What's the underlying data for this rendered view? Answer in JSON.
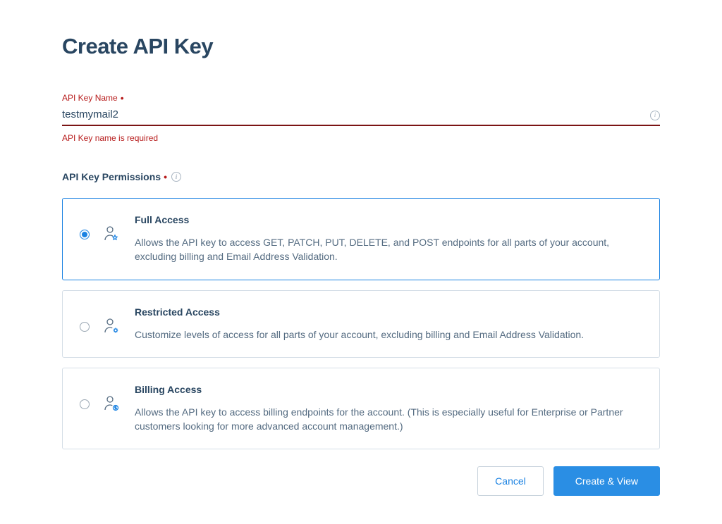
{
  "page_title": "Create API Key",
  "name_field": {
    "label": "API Key Name",
    "value": "testmymail2",
    "error": "API Key name is required"
  },
  "permissions_label": "API Key Permissions",
  "options": [
    {
      "key": "full",
      "title": "Full Access",
      "description": "Allows the API key to access GET, PATCH, PUT, DELETE, and POST endpoints for all parts of your account, excluding billing and Email Address Validation.",
      "selected": true
    },
    {
      "key": "restricted",
      "title": "Restricted Access",
      "description": "Customize levels of access for all parts of your account, excluding billing and Email Address Validation.",
      "selected": false
    },
    {
      "key": "billing",
      "title": "Billing Access",
      "description": "Allows the API key to access billing endpoints for the account. (This is especially useful for Enterprise or Partner customers looking for more advanced account management.)",
      "selected": false
    }
  ],
  "buttons": {
    "cancel": "Cancel",
    "submit": "Create & View"
  }
}
